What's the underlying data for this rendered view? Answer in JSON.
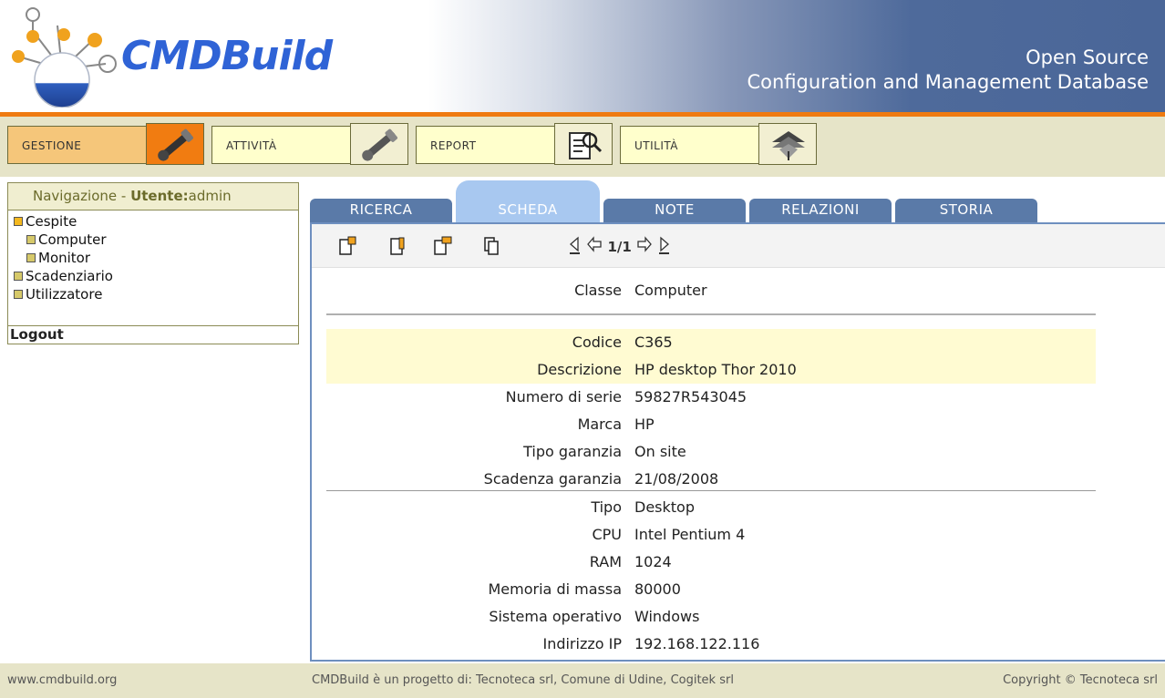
{
  "header": {
    "logo_text": "CMDBuild",
    "tagline_line1": "Open Source",
    "tagline_line2": "Configuration and Management Database"
  },
  "menu": [
    {
      "label": "GESTIONE",
      "icon": "wrench-icon",
      "active": true
    },
    {
      "label": "ATTIVITÀ",
      "icon": "wrench-icon",
      "active": false
    },
    {
      "label": "REPORT",
      "icon": "report-magnifier-icon",
      "active": false
    },
    {
      "label": "UTILITÀ",
      "icon": "stack-arrows-icon",
      "active": false
    }
  ],
  "sidebar": {
    "title_prefix": "Navigazione - ",
    "user_label": "Utente:",
    "user_name": "admin",
    "tree": [
      {
        "label": "Cespite",
        "level": 0
      },
      {
        "label": "Computer",
        "level": 1
      },
      {
        "label": "Monitor",
        "level": 1
      },
      {
        "label": "Scadenziario",
        "level": 0
      },
      {
        "label": "Utilizzatore",
        "level": 0
      }
    ],
    "logout": "Logout"
  },
  "tabs": [
    {
      "label": "RICERCA",
      "active": false
    },
    {
      "label": "SCHEDA",
      "active": true
    },
    {
      "label": "NOTE",
      "active": false
    },
    {
      "label": "RELAZIONI",
      "active": false
    },
    {
      "label": "STORIA",
      "active": false
    }
  ],
  "toolbar": {
    "icons": [
      "new-card-icon",
      "edit-card-icon",
      "delete-card-icon",
      "clone-card-icon"
    ],
    "pager_text": "1/1"
  },
  "card": {
    "classe_label": "Classe",
    "classe_value": "Computer",
    "fields_highlight": [
      {
        "key": "Codice",
        "value": "C365"
      },
      {
        "key": "Descrizione",
        "value": "HP desktop Thor 2010"
      }
    ],
    "fields_general": [
      {
        "key": "Numero di serie",
        "value": "59827R543045"
      },
      {
        "key": "Marca",
        "value": "HP"
      },
      {
        "key": "Tipo garanzia",
        "value": "On site"
      },
      {
        "key": "Scadenza garanzia",
        "value": "21/08/2008"
      }
    ],
    "fields_tech": [
      {
        "key": "Tipo",
        "value": "Desktop"
      },
      {
        "key": "CPU",
        "value": "Intel Pentium 4"
      },
      {
        "key": "RAM",
        "value": "1024"
      },
      {
        "key": "Memoria di massa",
        "value": "80000"
      },
      {
        "key": "Sistema operativo",
        "value": "Windows"
      },
      {
        "key": "Indirizzo IP",
        "value": "192.168.122.116"
      }
    ]
  },
  "footer": {
    "left": "www.cmdbuild.org",
    "center": "CMDBuild è un progetto di: Tecnoteca srl, Comune di Udine, Cogitek srl",
    "right": "Copyright © Tecnoteca srl"
  },
  "colors": {
    "accent_orange": "#ef7b11",
    "header_blue": "#4a6698",
    "tab_blue": "#5a7aa8",
    "tab_active": "#a8c8f0",
    "menu_bg": "#e6e4c8",
    "highlight_row": "#fffbd2"
  }
}
